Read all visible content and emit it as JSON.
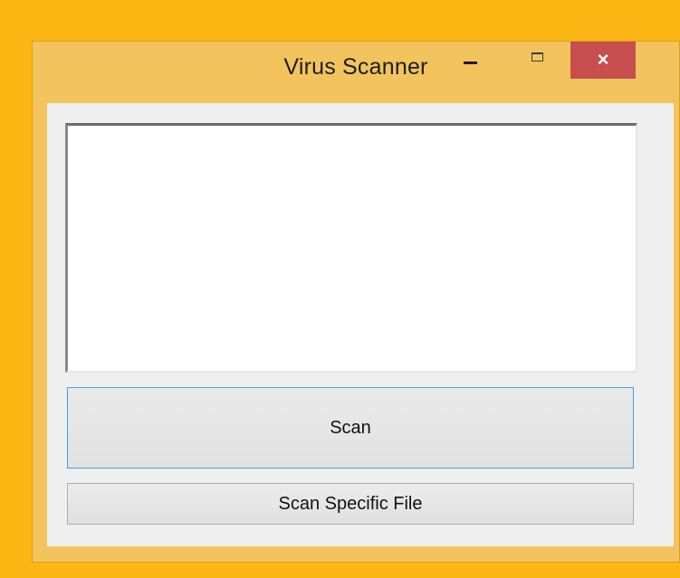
{
  "window": {
    "title": "Virus Scanner",
    "controls": {
      "minimize_icon": "minimize-icon",
      "maximize_icon": "maximize-icon",
      "close_icon": "close-icon",
      "close_glyph": "×"
    }
  },
  "main": {
    "output_text": "",
    "scan_label": "Scan",
    "scan_file_label": "Scan Specific File"
  },
  "colors": {
    "desktop": "#fcb714",
    "window_frame": "#f3c45e",
    "close_button": "#c74e4e",
    "focus_border": "#3f9fe8"
  }
}
